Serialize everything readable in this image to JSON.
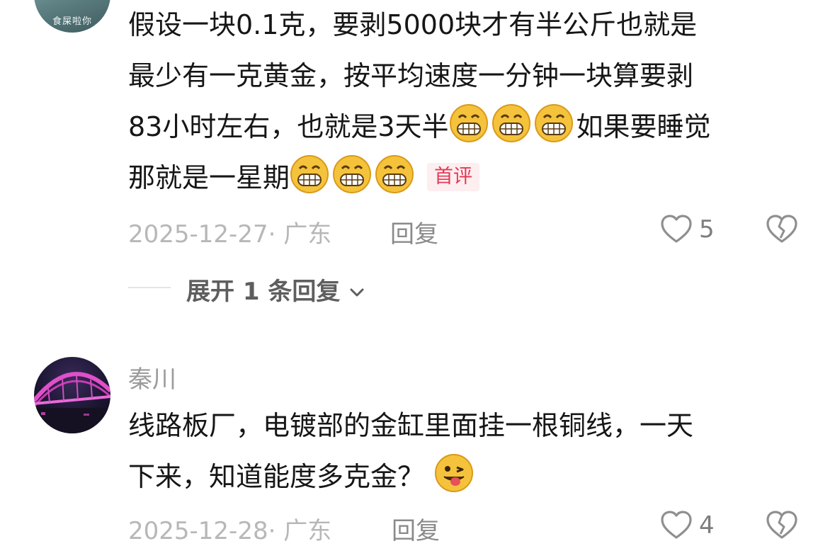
{
  "comment1": {
    "avatar_text": "食屎啦你",
    "lines": [
      "假设一块0.1克，要剥5000块才有半公斤也就是",
      "最少有一克黄金，按平均速度一分钟一块算要剥",
      "83小时左右，也就是3天半",
      "如果要睡觉",
      "那就是一星期"
    ],
    "emojis": [
      "grin-emoji",
      "grin-emoji",
      "grin-emoji",
      "grin-emoji",
      "grin-emoji",
      "grin-emoji"
    ],
    "badge": "首评",
    "date": "2025-12-27",
    "location": "· 广东",
    "reply_label": "回复",
    "like_count": "5",
    "expand_label": "展开 1 条回复"
  },
  "comment2": {
    "username": "秦川",
    "lines": [
      "线路板厂，电镀部的金缸里面挂一根铜线，一天",
      "下来，知道能度多克金？"
    ],
    "emojis": [
      "wink-tongue-emoji"
    ],
    "date": "2025-12-28",
    "location": "· 广东",
    "reply_label": "回复",
    "like_count": "4"
  },
  "colors": {
    "badge_text": "#e33a56",
    "badge_bg": "#fdeef0",
    "meta": "#b7b7b7",
    "emoji_face": "#f5c33b"
  }
}
